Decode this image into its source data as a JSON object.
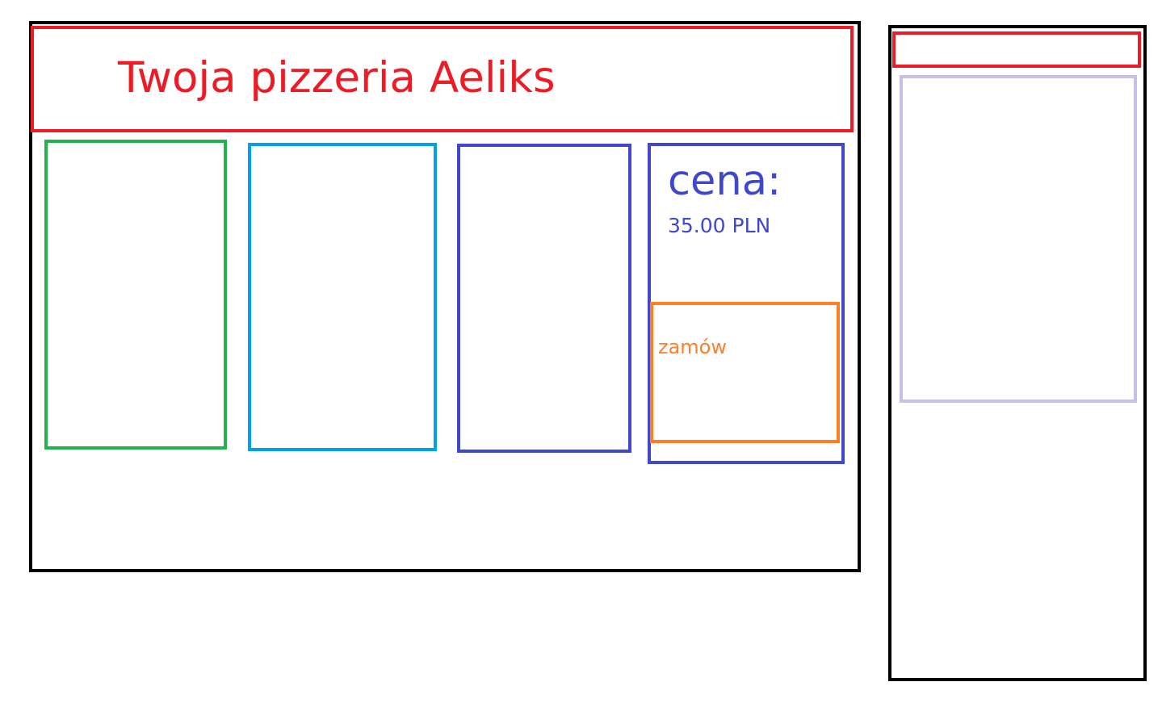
{
  "header": {
    "title": "Twoja pizzeria Aeliks"
  },
  "product": {
    "price_label": "cena:",
    "price_value": "35.00 PLN",
    "order_label": "zamów"
  },
  "colors": {
    "frame": "#000000",
    "header": "#ed1c24",
    "card1": "#22b14c",
    "card2": "#00a2e8",
    "card3": "#3f48cc",
    "price_card": "#3f48cc",
    "order": "#ff7f27",
    "side_content": "#c8bfe7"
  }
}
